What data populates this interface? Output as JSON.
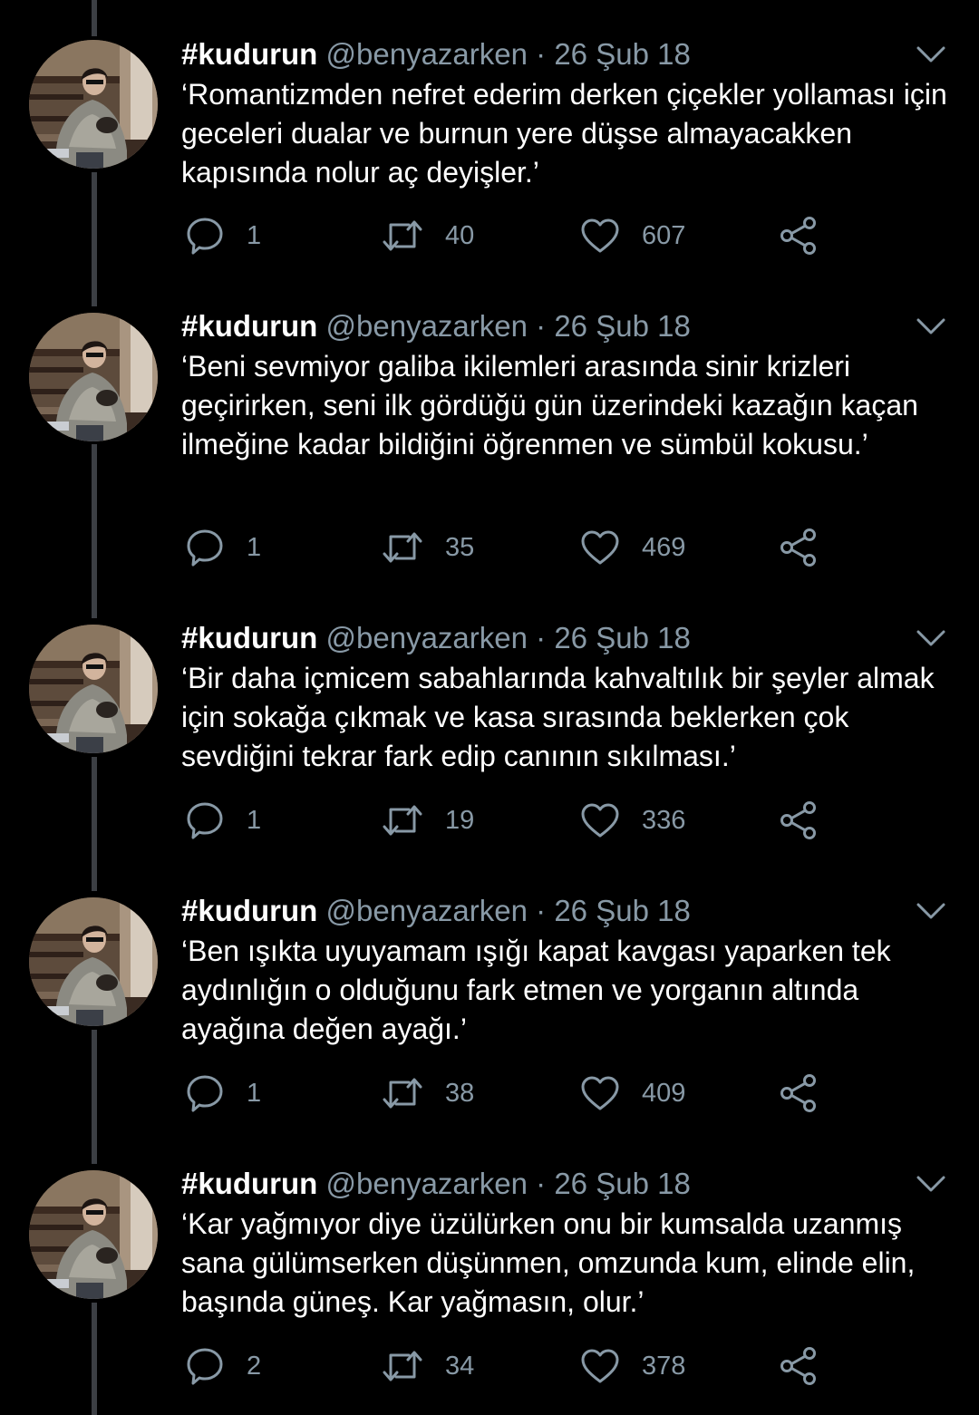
{
  "colors": {
    "background": "#000000",
    "text": "#ffffff",
    "muted": "#8899a6",
    "thread_line": "#3c3f44"
  },
  "icons": {
    "reply": "reply-icon",
    "retweet": "retweet-icon",
    "like": "heart-icon",
    "share": "share-icon",
    "menu": "chevron-down-icon"
  },
  "tweets": [
    {
      "display_name": "#kudurun",
      "handle": "@benyazarken",
      "separator": "·",
      "date": "26 Şub 18",
      "text": "‘Romantizmden nefret ederim derken çiçekler yollaması için geceleri dualar ve burnun yere düşse almayacakken kapısında nolur aç deyişler.’",
      "replies": "1",
      "retweets": "40",
      "likes": "607"
    },
    {
      "display_name": "#kudurun",
      "handle": "@benyazarken",
      "separator": "·",
      "date": "26 Şub 18",
      "text": "‘Beni sevmiyor galiba ikilemleri arasında sinir krizleri geçirirken, seni ilk gördüğü gün üzerindeki kazağın kaçan ilmeğine kadar bildiğini öğrenmen ve sümbül kokusu.’",
      "replies": "1",
      "retweets": "35",
      "likes": "469"
    },
    {
      "display_name": "#kudurun",
      "handle": "@benyazarken",
      "separator": "·",
      "date": "26 Şub 18",
      "text": "‘Bir daha içmicem sabahlarında kahvaltılık bir şeyler almak için sokağa çıkmak ve kasa sırasında beklerken çok sevdiğini tekrar fark edip canının sıkılması.’",
      "replies": "1",
      "retweets": "19",
      "likes": "336"
    },
    {
      "display_name": "#kudurun",
      "handle": "@benyazarken",
      "separator": "·",
      "date": "26 Şub 18",
      "text": "‘Ben ışıkta uyuyamam ışığı kapat kavgası yaparken tek aydınlığın o olduğunu fark etmen ve yorganın altında ayağına değen ayağı.’",
      "replies": "1",
      "retweets": "38",
      "likes": "409"
    },
    {
      "display_name": "#kudurun",
      "handle": "@benyazarken",
      "separator": "·",
      "date": "26 Şub 18",
      "text": "‘Kar yağmıyor diye üzülürken onu bir kumsalda uzanmış sana gülümserken düşünmen, omzunda kum, elinde elin, başında güneş. Kar yağmasın, olur.’",
      "replies": "2",
      "retweets": "34",
      "likes": "378"
    }
  ]
}
